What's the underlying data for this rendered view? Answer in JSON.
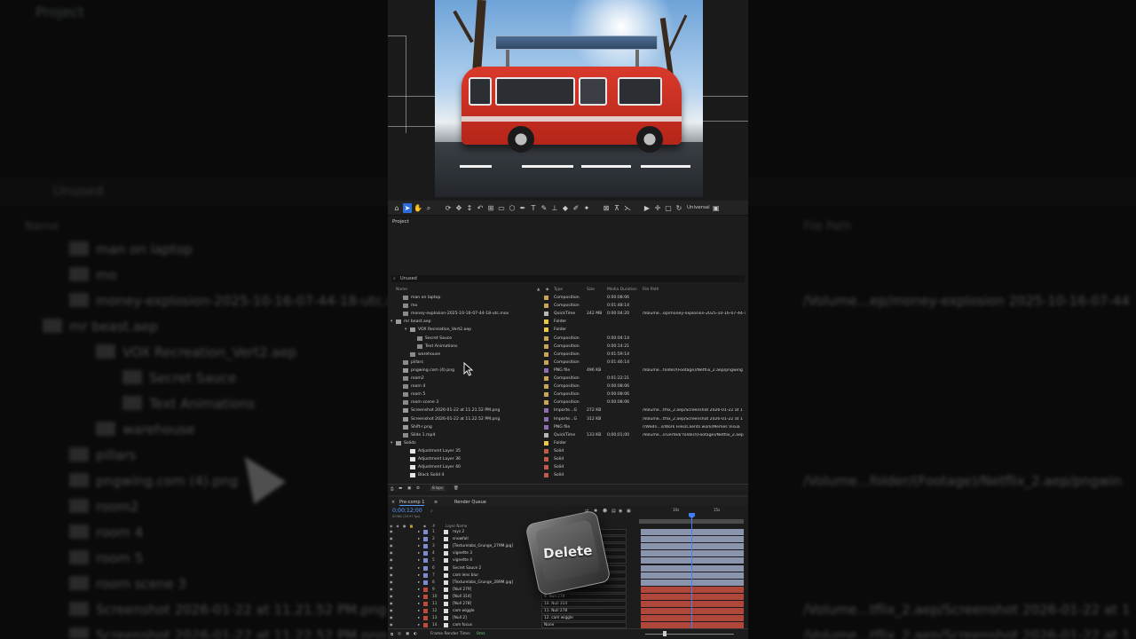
{
  "background": {
    "panel_title": "Project",
    "search_text": "Unused",
    "col_name": "Name",
    "col_filepath": "File Path",
    "items": [
      {
        "name": "man on laptop"
      },
      {
        "name": "mo"
      },
      {
        "name": "money-explosion-2025-10-16-07-44-18-utc.mov",
        "path": "/Volume...ep/money-explosion 2025-10-16-07-44"
      },
      {
        "name": "mr beast.aep"
      },
      {
        "name": "VOX Recreation_Vert2.aep"
      },
      {
        "name": "Secret Sauce"
      },
      {
        "name": "Text Animations"
      },
      {
        "name": "warehouse"
      },
      {
        "name": "pillars"
      },
      {
        "name": "pngwing.com (4).png",
        "path": "/Volume...folder/(Footage)/Netflix_2.aep/pngwin"
      },
      {
        "name": "room2"
      },
      {
        "name": "room 4"
      },
      {
        "name": "room 5"
      },
      {
        "name": "room scene 3"
      },
      {
        "name": "Screenshot 2026-01-22 at 11.21.52 PM.png",
        "path": "/Volume...tflix_2.aep/Screenshot 2026-01-22 at 1"
      },
      {
        "name": "Screenshot 2026-01-22 at 11.22.52 PM.png",
        "path": "/Volume...tflix_2.aep/Screenshot 2026-01-22 at 1"
      }
    ]
  },
  "toolbar": {
    "workspace_label": "Universal"
  },
  "project": {
    "title": "Project",
    "search": "Unused",
    "columns": {
      "name": "Name",
      "type": "Type",
      "size": "Size",
      "duration": "Media Duration",
      "path": "File Path"
    },
    "rows": [
      {
        "name": "man on laptop",
        "indent": 1,
        "icon": "composition",
        "label_color": "#c9a657",
        "type": "Composition",
        "size": "",
        "duration": "0:00:08:06",
        "path": ""
      },
      {
        "name": "mo",
        "indent": 1,
        "icon": "composition",
        "label_color": "#c9a657",
        "type": "Composition",
        "size": "",
        "duration": "0:01:48:14",
        "path": ""
      },
      {
        "name": "money-explosion-2025-10-16-07-44-18-utc.mov",
        "indent": 1,
        "icon": "footage",
        "label_color": "#b7b7b7",
        "type": "QuickTime",
        "size": "242 MB",
        "duration": "0:00:04:20",
        "path": "/Volume...ep/money-explosion-2025-10-16-07-44-18-utc"
      },
      {
        "name": "mr beast.aep",
        "indent": 0,
        "icon": "folder",
        "label_color": "#e8c84a",
        "type": "Folder",
        "size": "",
        "duration": "",
        "path": ""
      },
      {
        "name": "VOX Recreation_Vert2.aep",
        "indent": 2,
        "icon": "folder",
        "label_color": "#e8c84a",
        "type": "Folder",
        "size": "",
        "duration": "",
        "path": ""
      },
      {
        "name": "Secret Sauce",
        "indent": 3,
        "icon": "composition",
        "label_color": "#c9a657",
        "type": "Composition",
        "size": "",
        "duration": "0:00:04:14",
        "path": ""
      },
      {
        "name": "Text Animations",
        "indent": 3,
        "icon": "composition",
        "label_color": "#c9a657",
        "type": "Composition",
        "size": "",
        "duration": "0:00:14:21",
        "path": ""
      },
      {
        "name": "warehouse",
        "indent": 2,
        "icon": "composition",
        "label_color": "#c9a657",
        "type": "Composition",
        "size": "",
        "duration": "0:01:59:14",
        "path": ""
      },
      {
        "name": "pillars",
        "indent": 1,
        "icon": "composition",
        "label_color": "#c9a657",
        "type": "Composition",
        "size": "",
        "duration": "0:01:46:14",
        "path": ""
      },
      {
        "name": "pngwing.com (4).png",
        "indent": 1,
        "icon": "image",
        "label_color": "#8c6fb0",
        "type": "PNG file",
        "size": "496 KB",
        "duration": "",
        "path": "/Volume...folder/(Footage)/Netflix_2.aep/pngwing"
      },
      {
        "name": "room2",
        "indent": 1,
        "icon": "composition",
        "label_color": "#c9a657",
        "type": "Composition",
        "size": "",
        "duration": "0:01:22:21",
        "path": ""
      },
      {
        "name": "room 4",
        "indent": 1,
        "icon": "composition",
        "label_color": "#c9a657",
        "type": "Composition",
        "size": "",
        "duration": "0:00:08:06",
        "path": ""
      },
      {
        "name": "room 5",
        "indent": 1,
        "icon": "composition",
        "label_color": "#c9a657",
        "type": "Composition",
        "size": "",
        "duration": "0:00:08:06",
        "path": ""
      },
      {
        "name": "room scene 3",
        "indent": 1,
        "icon": "composition",
        "label_color": "#c9a657",
        "type": "Composition",
        "size": "",
        "duration": "0:00:08:06",
        "path": ""
      },
      {
        "name": "Screenshot 2026-01-22 at 11.21.52 PM.png",
        "indent": 1,
        "icon": "image",
        "label_color": "#8c6fb0",
        "type": "Importe...G",
        "size": "272 KB",
        "duration": "",
        "path": "/Volume...tflix_2.aep/Screenshot 2026-01-22 at 1"
      },
      {
        "name": "Screenshot 2026-01-22 at 11.22.52 PM.png",
        "indent": 1,
        "icon": "image",
        "label_color": "#8c6fb0",
        "type": "Importe...G",
        "size": "312 KB",
        "duration": "",
        "path": "/Volume...tflix_2.aep/Screenshot 2026-01-22 at 1"
      },
      {
        "name": "Shift-r.png",
        "indent": 1,
        "icon": "image",
        "label_color": "#8c6fb0",
        "type": "PNG file",
        "size": "",
        "duration": "",
        "path": "r/Wedn...s/Work Files/Clients work/Memes Visua"
      },
      {
        "name": "Slide 1.mp4",
        "indent": 1,
        "icon": "footage",
        "label_color": "#b7b7b7",
        "type": "QuickTime",
        "size": "133 KB",
        "duration": "0;00;01;00",
        "path": "/Volume...inverted/ folder/(Footage)/Netflix_2.aep"
      },
      {
        "name": "Solids",
        "indent": 0,
        "icon": "folder",
        "label_color": "#e8c84a",
        "type": "Folder",
        "size": "",
        "duration": "",
        "path": ""
      },
      {
        "name": "Adjustment Layer 35",
        "indent": 2,
        "icon": "solid",
        "label_color": "#c05a4a",
        "type": "Solid",
        "size": "",
        "duration": "",
        "path": ""
      },
      {
        "name": "Adjustment Layer 36",
        "indent": 2,
        "icon": "solid",
        "label_color": "#c05a4a",
        "type": "Solid",
        "size": "",
        "duration": "",
        "path": ""
      },
      {
        "name": "Adjustment Layer 40",
        "indent": 2,
        "icon": "solid",
        "label_color": "#c05a4a",
        "type": "Solid",
        "size": "",
        "duration": "",
        "path": ""
      },
      {
        "name": "Black Solid 4",
        "indent": 2,
        "icon": "solid",
        "label_color": "#c05a4a",
        "type": "Solid",
        "size": "",
        "duration": "",
        "path": ""
      }
    ],
    "footer_bpc": "8 bpc"
  },
  "timeline": {
    "tab_active": "Pre-comp 1",
    "tab_render": "Render Queue",
    "timecode": "0;00;12;00",
    "timecode_sub": "00360 (29.97 fps)",
    "col_layer_name": "Layer Name",
    "ruler_labels": [
      "10s",
      "15s"
    ],
    "layers": [
      {
        "num": "1",
        "name": "rays 2",
        "label_color": "#7c8ccc",
        "parent": "None",
        "bar_color": "#8a94ad"
      },
      {
        "num": "2",
        "name": "snowfall",
        "label_color": "#7c8ccc",
        "parent": "None",
        "bar_color": "#8a94ad"
      },
      {
        "num": "3",
        "name": "[Texturelabs_Grunge_279M.jpg]",
        "label_color": "#7c8ccc",
        "parent": "None",
        "bar_color": "#8a94ad"
      },
      {
        "num": "4",
        "name": "vignette 3",
        "label_color": "#7c8ccc",
        "parent": "None",
        "bar_color": "#8a94ad"
      },
      {
        "num": "5",
        "name": "vignette 4",
        "label_color": "#7c8ccc",
        "parent": "None",
        "bar_color": "#8a94ad"
      },
      {
        "num": "6",
        "name": "Secret Sauce 2",
        "label_color": "#7c8ccc",
        "parent": "None",
        "bar_color": "#8a94ad"
      },
      {
        "num": "7",
        "name": "cam lens blur",
        "label_color": "#7c8ccc",
        "parent": "None",
        "bar_color": "#8a94ad"
      },
      {
        "num": "8",
        "name": "[Texturelabs_Grunge_289M.jpg]",
        "label_color": "#7c8ccc",
        "parent": "None",
        "bar_color": "#8a94ad"
      },
      {
        "num": "9",
        "name": "[Null 279]",
        "label_color": "#c04a3a",
        "parent": "None",
        "bar_color": "#b0473a"
      },
      {
        "num": "10",
        "name": "[Null 314]",
        "label_color": "#c04a3a",
        "parent": "9. Null 279",
        "bar_color": "#b0473a"
      },
      {
        "num": "11",
        "name": "[Null 278]",
        "label_color": "#c04a3a",
        "parent": "10. Null 314",
        "bar_color": "#b0473a"
      },
      {
        "num": "12",
        "name": "cam wiggle",
        "label_color": "#c04a3a",
        "parent": "11. Null 278",
        "bar_color": "#b0473a"
      },
      {
        "num": "13",
        "name": "[Null 2]",
        "label_color": "#c04a3a",
        "parent": "12. cam wiggle",
        "bar_color": "#b0473a"
      },
      {
        "num": "14",
        "name": "cam focus",
        "label_color": "#c04a3a",
        "parent": "None",
        "bar_color": "#b0473a"
      }
    ],
    "footer_label": "Frame Render Time:",
    "footer_value": "0ms"
  },
  "overlay": {
    "delete_key_label": "Delete"
  }
}
